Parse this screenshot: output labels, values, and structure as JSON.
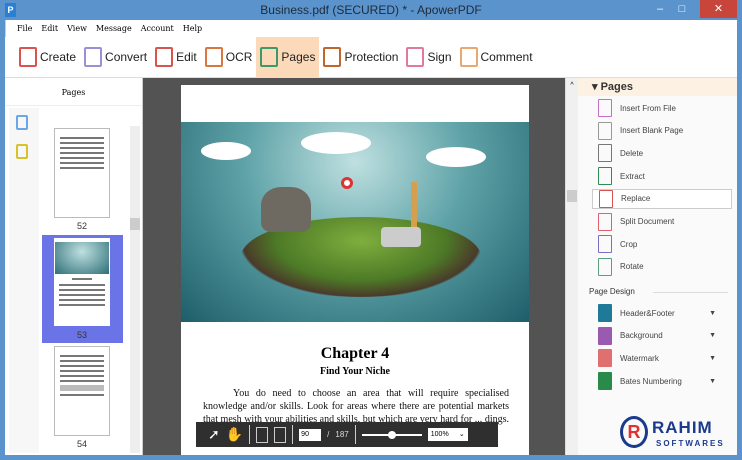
{
  "window": {
    "title": "Business.pdf (SECURED) * - ApowerPDF",
    "app_icon": "P",
    "minimize": "–",
    "maximize": "□",
    "close": "✕"
  },
  "menu": [
    "File",
    "Edit",
    "View",
    "Message",
    "Account",
    "Help"
  ],
  "toolbar": [
    {
      "label": "Create",
      "color": "#d9534f"
    },
    {
      "label": "Convert",
      "color": "#9b8fd6"
    },
    {
      "label": "Edit",
      "color": "#d9534f"
    },
    {
      "label": "OCR",
      "color": "#d9773f"
    },
    {
      "label": "Pages",
      "color": "#3c9a6a"
    },
    {
      "label": "Protection",
      "color": "#c0652b"
    },
    {
      "label": "Sign",
      "color": "#e07a9a"
    },
    {
      "label": "Comment",
      "color": "#e8a870"
    }
  ],
  "left_panel": {
    "title": "Pages",
    "thumbnails": [
      {
        "page": "52"
      },
      {
        "page": "53",
        "selected": true
      },
      {
        "page": "54"
      }
    ]
  },
  "document": {
    "heading": "Chapter 4",
    "subheading": "Find Your Niche",
    "body": "You do need to choose an area that will require specialised knowledge and/or skills. Look for areas where there are potential markets that mesh with your abilities and skills, but which are very hard for ... dings. As soon as it was proved that there was a viable market for"
  },
  "navbar": {
    "current_page": "90",
    "separator": "/",
    "total_pages": "187",
    "zoom": "100%",
    "zoom_level": 0.5
  },
  "right_panel": {
    "section": "Pages",
    "items": [
      {
        "label": "Insert From File",
        "color": "#c56fc4"
      },
      {
        "label": "Insert Blank Page",
        "color": "#999999"
      },
      {
        "label": "Delete",
        "color": "#777777"
      },
      {
        "label": "Extract",
        "color": "#2e8b57"
      },
      {
        "label": "Replace",
        "color": "#d9534f",
        "selected": true
      },
      {
        "label": "Split Document",
        "color": "#e06070"
      },
      {
        "label": "Crop",
        "color": "#7a6fc4"
      },
      {
        "label": "Rotate",
        "color": "#5aa080"
      }
    ],
    "design_title": "Page Design",
    "design_items": [
      {
        "label": "Header&Footer",
        "color": "#1f7a9a"
      },
      {
        "label": "Background",
        "color": "#9a5ab0"
      },
      {
        "label": "Watermark",
        "color": "#e07070"
      },
      {
        "label": "Bates Numbering",
        "color": "#2a8a4a"
      }
    ]
  },
  "watermark_logo": {
    "text": "RAHIM",
    "sub": "SOFTWARES"
  }
}
